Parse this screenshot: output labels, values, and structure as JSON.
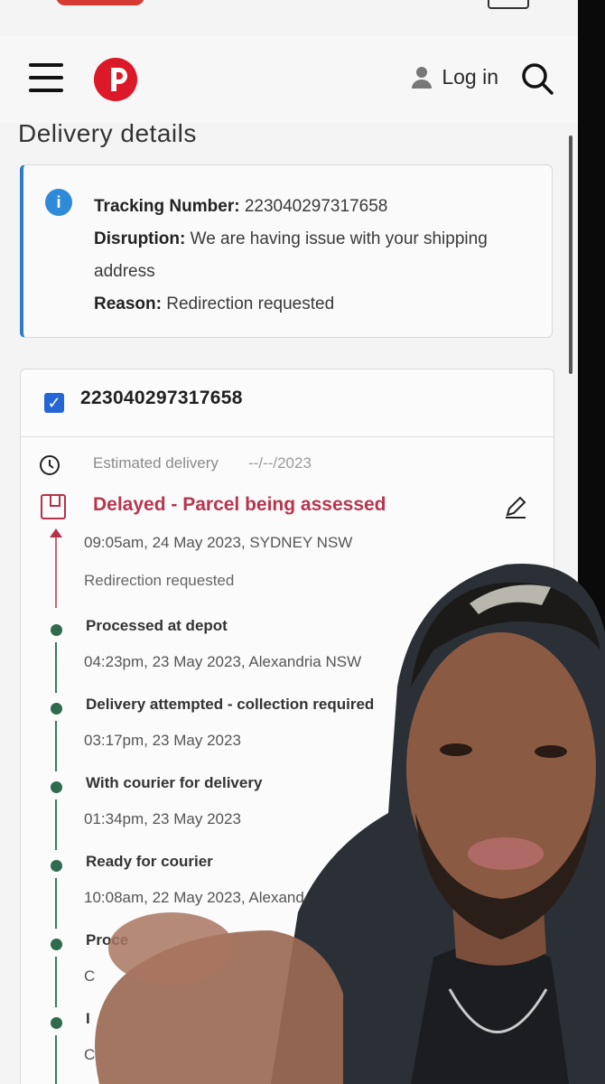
{
  "header": {
    "login_label": "Log in"
  },
  "page": {
    "title": "Delivery details"
  },
  "info": {
    "tracking_label": "Tracking Number:",
    "tracking_value": "223040297317658",
    "disruption_label": "Disruption:",
    "disruption_value": "We are having issue with your shipping address",
    "reason_label": "Reason:",
    "reason_value": "Redirection requested"
  },
  "tracking": {
    "number": "223040297317658",
    "eta_label": "Estimated delivery",
    "eta_value": "--/--/2023",
    "status": "Delayed - Parcel being assessed",
    "status_time": "09:05am, 24 May 2023, SYDNEY NSW",
    "status_note": "Redirection requested",
    "events": [
      {
        "title": "Processed at depot",
        "when": "04:23pm, 23 May 2023, Alexandria NSW"
      },
      {
        "title": "Delivery attempted - collection required",
        "when": "03:17pm, 23 May 2023"
      },
      {
        "title": "With courier for delivery",
        "when": "01:34pm, 23 May 2023"
      },
      {
        "title": "Ready for courier",
        "when": "10:08am, 22 May 2023, Alexand"
      },
      {
        "title": "Proce",
        "when": "C"
      },
      {
        "title": "I",
        "when": "C"
      }
    ]
  },
  "colors": {
    "accent_blue": "#2f7cc4",
    "status_red": "#b7364e",
    "timeline_green": "#2f6b4e",
    "brand_red": "#dc1928"
  }
}
